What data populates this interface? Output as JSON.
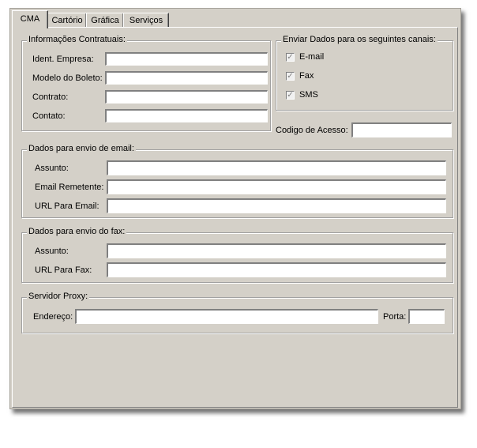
{
  "tabs": [
    {
      "label": "CMA",
      "active": true
    },
    {
      "label": "Cartório",
      "active": false
    },
    {
      "label": "Gráfica",
      "active": false
    },
    {
      "label": "Serviços",
      "active": false
    }
  ],
  "contratuais": {
    "legend": "Informações Contratuais:",
    "fields": [
      {
        "label": "Ident. Empresa:",
        "value": ""
      },
      {
        "label": "Modelo do Boleto:",
        "value": ""
      },
      {
        "label": "Contrato:",
        "value": ""
      },
      {
        "label": "Contato:",
        "value": ""
      }
    ]
  },
  "canais": {
    "legend": "Enviar Dados para os seguintes canais:",
    "options": [
      {
        "label": "E-mail",
        "checked": true,
        "check_glyph": "✓"
      },
      {
        "label": "Fax",
        "checked": true,
        "check_glyph": "✓"
      },
      {
        "label": "SMS",
        "checked": true,
        "check_glyph": "✓"
      }
    ]
  },
  "codigo_acesso": {
    "label": "Codigo de Acesso:",
    "value": ""
  },
  "email": {
    "legend": "Dados para envio de email:",
    "fields": [
      {
        "label": "Assunto:",
        "value": ""
      },
      {
        "label": "Email Remetente:",
        "value": ""
      },
      {
        "label": "URL Para Email:",
        "value": ""
      }
    ]
  },
  "fax": {
    "legend": "Dados para envio do fax:",
    "fields": [
      {
        "label": "Assunto:",
        "value": ""
      },
      {
        "label": "URL Para Fax:",
        "value": ""
      }
    ]
  },
  "proxy": {
    "legend": "Servidor Proxy:",
    "endereco_label": "Endereço:",
    "endereco_value": "",
    "porta_label": "Porta:",
    "porta_value": ""
  },
  "colors": {
    "window_bg": "#d4d0c8",
    "field_bg": "#ffffff"
  }
}
